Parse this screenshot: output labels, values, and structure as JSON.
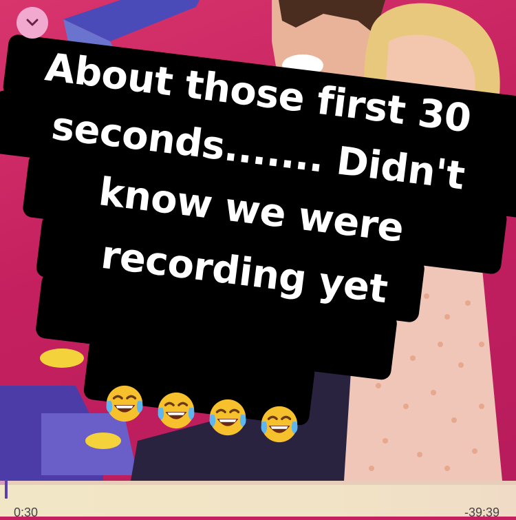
{
  "caption": {
    "lines": [
      "About those first 30",
      "seconds....... Didn't",
      "know we were",
      "recording yet"
    ]
  },
  "emoji": {
    "name": "face-with-tears-of-joy-icon",
    "count": 4
  },
  "player": {
    "elapsed": "0:30",
    "remaining": "-39:39",
    "progress_fraction": 0.0126
  },
  "colors": {
    "background": "#c4205f",
    "accent": "#5a3fb2",
    "chevron_bg": "#f2a9cf"
  },
  "icons": {
    "collapse": "chevron-down-icon"
  }
}
